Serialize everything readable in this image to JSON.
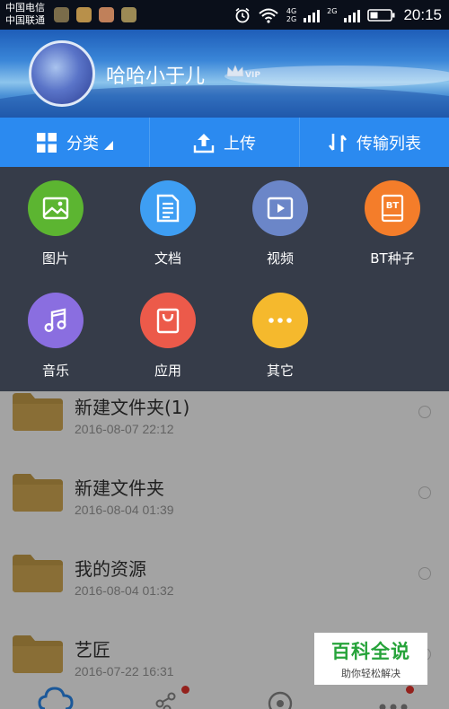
{
  "status_bar": {
    "carrier_1": "中国电信",
    "carrier_2": "中国联通",
    "net_1": "4G",
    "net_2": "2G",
    "net_3": "2G",
    "time": "20:15"
  },
  "profile": {
    "username": "哈哈小于儿",
    "vip_badge": "VIP"
  },
  "toolbar": {
    "category_label": "分类",
    "upload_label": "上传",
    "transfer_label": "传输列表"
  },
  "categories": [
    {
      "label": "图片",
      "icon": "image-icon",
      "color": "#5cb531"
    },
    {
      "label": "文档",
      "icon": "document-icon",
      "color": "#3e9ef3"
    },
    {
      "label": "视频",
      "icon": "video-icon",
      "color": "#6b86c8"
    },
    {
      "label": "BT种子",
      "icon": "bt-icon",
      "color": "#f47d2a"
    },
    {
      "label": "音乐",
      "icon": "music-icon",
      "color": "#8a6ee0"
    },
    {
      "label": "应用",
      "icon": "app-icon",
      "color": "#ec5a4a"
    },
    {
      "label": "其它",
      "icon": "more-icon",
      "color": "#f5b92d"
    }
  ],
  "files": [
    {
      "name": "新建文件夹(1)",
      "date": "2016-08-07  22:12"
    },
    {
      "name": "新建文件夹",
      "date": "2016-08-04  01:39"
    },
    {
      "name": "我的资源",
      "date": "2016-08-04  01:32"
    },
    {
      "name": "艺匠",
      "date": "2016-07-22  16:31"
    }
  ],
  "watermark": {
    "title": "百科全说",
    "subtitle": "助你轻松解决"
  },
  "colors": {
    "toolbar_blue": "#2b8af0",
    "panel_bg": "#363c49",
    "folder_yellow": "#c9a04a"
  }
}
